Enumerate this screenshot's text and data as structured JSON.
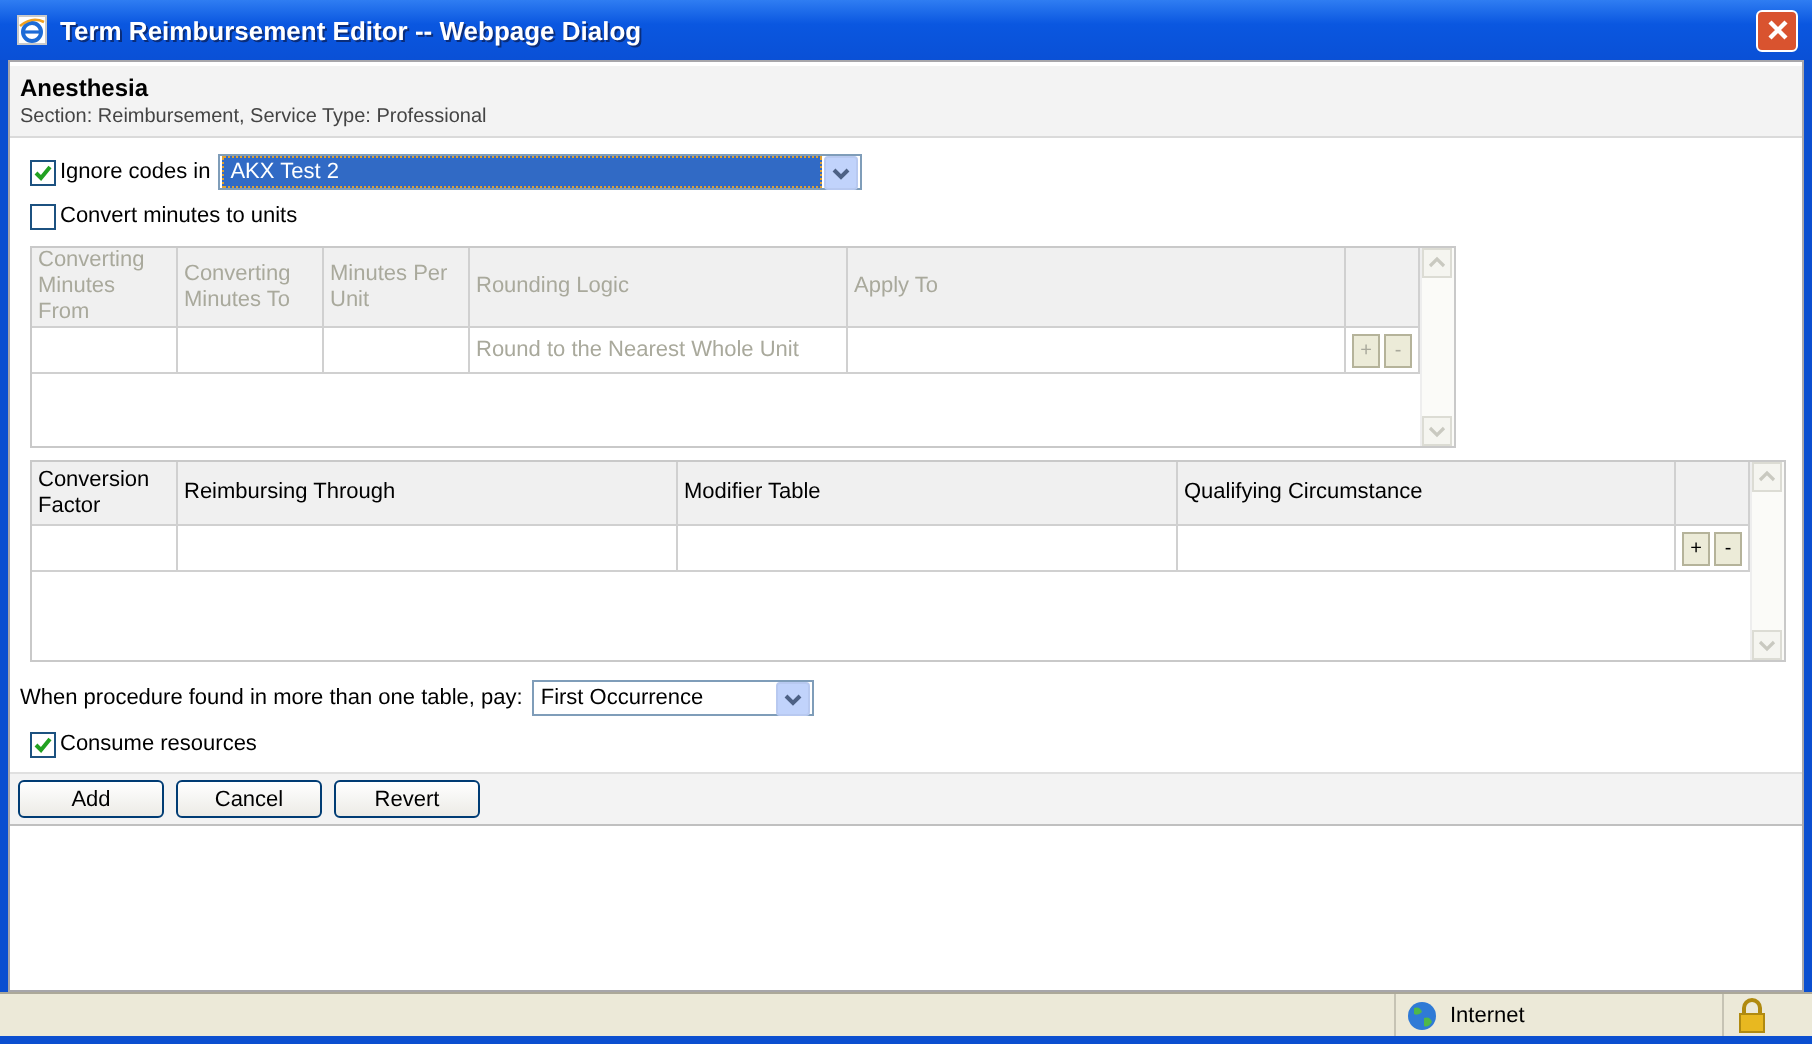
{
  "window": {
    "title": "Term Reimbursement Editor -- Webpage Dialog"
  },
  "header": {
    "title": "Anesthesia",
    "subtitle": "Section: Reimbursement, Service Type: Professional"
  },
  "ignore_codes": {
    "label": "Ignore codes in",
    "checked": true,
    "value": "AKX Test 2"
  },
  "convert_minutes": {
    "label": "Convert minutes to units",
    "checked": false
  },
  "tables": [
    {
      "disabled": true,
      "columns": [
        "Converting Minutes From",
        "Converting Minutes To",
        "Minutes Per Unit",
        "Rounding Logic",
        "Apply To"
      ],
      "rows": [
        [
          null,
          null,
          null,
          "Round to the Nearest Whole Unit",
          null
        ]
      ],
      "add": "+",
      "remove": "-"
    },
    {
      "disabled": false,
      "columns": [
        "Conversion Factor",
        "Reimbursing Through",
        "Modifier Table",
        "Qualifying Circumstance"
      ],
      "rows": [
        [
          null,
          null,
          null,
          null
        ]
      ],
      "add": "+",
      "remove": "-"
    }
  ],
  "pay": {
    "label": "When procedure found in more than one table, pay:",
    "value": "First Occurrence"
  },
  "consume": {
    "label": "Consume resources",
    "checked": true
  },
  "buttons": [
    "Add",
    "Cancel",
    "Revert"
  ],
  "status_bar": {
    "zone": "Internet"
  }
}
